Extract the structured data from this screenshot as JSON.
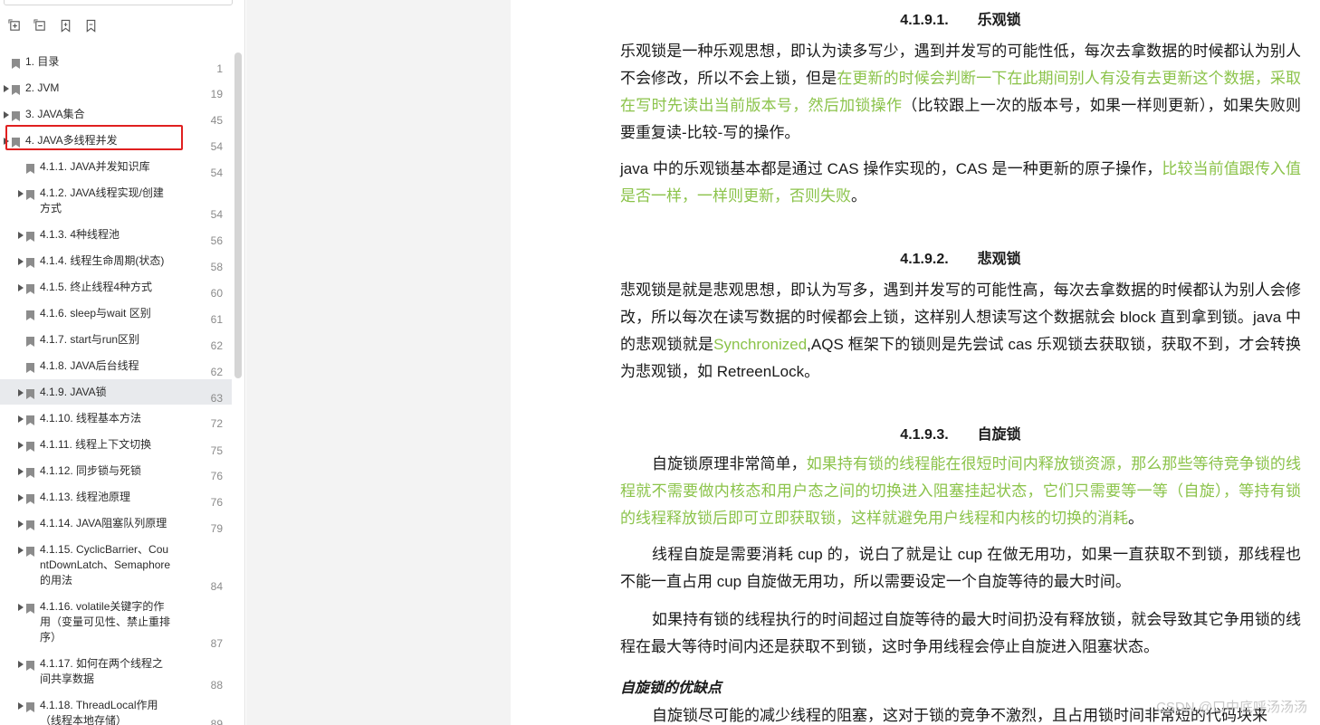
{
  "toolbar": {
    "buttons": [
      {
        "name": "expand-all-icon"
      },
      {
        "name": "collapse-all-icon"
      },
      {
        "name": "add-bookmark-icon"
      },
      {
        "name": "bookmark-icon"
      }
    ]
  },
  "outline": {
    "items": [
      {
        "label": "1. 目录",
        "page": "1",
        "expandable": false,
        "level": 0
      },
      {
        "label": "2. JVM",
        "page": "19",
        "expandable": true,
        "level": 0
      },
      {
        "label": "3. JAVA集合",
        "page": "45",
        "expandable": true,
        "level": 0
      },
      {
        "label": "4. JAVA多线程并发",
        "page": "54",
        "expandable": true,
        "level": 0,
        "highlighted": true
      },
      {
        "label": "4.1.1. JAVA并发知识库",
        "page": "54",
        "expandable": false,
        "level": 1
      },
      {
        "label": "4.1.2. JAVA线程实现/创建方式",
        "page": "54",
        "expandable": true,
        "level": 1
      },
      {
        "label": "4.1.3. 4种线程池",
        "page": "56",
        "expandable": true,
        "level": 1
      },
      {
        "label": "4.1.4. 线程生命周期(状态)",
        "page": "58",
        "expandable": true,
        "level": 1
      },
      {
        "label": "4.1.5. 终止线程4种方式",
        "page": "60",
        "expandable": true,
        "level": 1
      },
      {
        "label": "4.1.6. sleep与wait 区别",
        "page": "61",
        "expandable": false,
        "level": 1
      },
      {
        "label": "4.1.7. start与run区别",
        "page": "62",
        "expandable": false,
        "level": 1
      },
      {
        "label": "4.1.8. JAVA后台线程",
        "page": "62",
        "expandable": false,
        "level": 1
      },
      {
        "label": "4.1.9. JAVA锁",
        "page": "63",
        "expandable": true,
        "level": 1,
        "selected": true
      },
      {
        "label": "4.1.10. 线程基本方法",
        "page": "72",
        "expandable": true,
        "level": 1
      },
      {
        "label": "4.1.11. 线程上下文切换",
        "page": "75",
        "expandable": true,
        "level": 1
      },
      {
        "label": "4.1.12. 同步锁与死锁",
        "page": "76",
        "expandable": true,
        "level": 1
      },
      {
        "label": "4.1.13. 线程池原理",
        "page": "76",
        "expandable": true,
        "level": 1
      },
      {
        "label": "4.1.14. JAVA阻塞队列原理",
        "page": "79",
        "expandable": true,
        "level": 1
      },
      {
        "label": "4.1.15. CyclicBarrier、CountDownLatch、Semaphore的用法",
        "page": "84",
        "expandable": true,
        "level": 1
      },
      {
        "label": "4.1.16. volatile关键字的作用（变量可见性、禁止重排序）",
        "page": "87",
        "expandable": true,
        "level": 1
      },
      {
        "label": "4.1.17. 如何在两个线程之间共享数据",
        "page": "88",
        "expandable": true,
        "level": 1
      },
      {
        "label": "4.1.18. ThreadLocal作用（线程本地存储）",
        "page": "89",
        "expandable": true,
        "level": 1
      }
    ]
  },
  "document": {
    "sections": [
      {
        "num": "4.1.9.1.",
        "title": "乐观锁",
        "paragraphs": [
          {
            "indent": false,
            "segments": [
              {
                "text": "乐观锁是一种乐观思想，即认为读多写少，遇到并发写的可能性低，每次去拿数据的时候都认为别人不会修改，所以不会上锁，但是",
                "green": false
              },
              {
                "text": "在更新的时候会判断一下在此期间别人有没有去更新这个数据，采取在写时先读出当前版本号，然后加锁操作",
                "green": true
              },
              {
                "text": "（比较跟上一次的版本号，如果一样则更新），如果失败则要重复读-比较-写的操作。",
                "green": false
              }
            ]
          },
          {
            "indent": false,
            "segments": [
              {
                "text": "java 中的乐观锁基本都是通过 CAS 操作实现的，CAS 是一种更新的原子操作，",
                "green": false
              },
              {
                "text": "比较当前值跟传入值是否一样，一样则更新，否则失败",
                "green": true
              },
              {
                "text": "。",
                "green": false
              }
            ]
          }
        ]
      },
      {
        "num": "4.1.9.2.",
        "title": "悲观锁",
        "paragraphs": [
          {
            "indent": false,
            "segments": [
              {
                "text": "悲观锁是就是悲观思想，即认为写多，遇到并发写的可能性高，每次去拿数据的时候都认为别人会修改，所以每次在读写数据的时候都会上锁，这样别人想读写这个数据就会 block 直到拿到锁。java 中的悲观锁就是",
                "green": false
              },
              {
                "text": "Synchronized",
                "green": true
              },
              {
                "text": ",AQS 框架下的锁则是先尝试 cas 乐观锁去获取锁，获取不到，才会转换为悲观锁，如 RetreenLock。",
                "green": false
              }
            ]
          }
        ]
      },
      {
        "num": "4.1.9.3.",
        "title": "自旋锁",
        "paragraphs": [
          {
            "indent": true,
            "segments": [
              {
                "text": "自旋锁原理非常简单，",
                "green": false
              },
              {
                "text": "如果持有锁的线程能在很短时间内释放锁资源，那么那些等待竞争锁的线程就不需要做内核态和用户态之间的切换进入阻塞挂起状态，它们只需要等一等（自旋），等持有锁的线程释放锁后即可立即获取锁，这样就避免用户线程和内核的切换的消耗",
                "green": true
              },
              {
                "text": "。",
                "green": false
              }
            ]
          },
          {
            "indent": true,
            "segments": [
              {
                "text": "线程自旋是需要消耗 cup 的，说白了就是让 cup 在做无用功，如果一直获取不到锁，那线程也不能一直占用 cup 自旋做无用功，所以需要设定一个自旋等待的最大时间。",
                "green": false
              }
            ]
          },
          {
            "indent": true,
            "segments": [
              {
                "text": "如果持有锁的线程执行的时间超过自旋等待的最大时间扔没有释放锁，就会导致其它争用锁的线程在最大等待时间内还是获取不到锁，这时争用线程会停止自旋进入阻塞状态。",
                "green": false
              }
            ]
          }
        ]
      }
    ],
    "subheading": "自旋锁的优缺点",
    "last_paragraph": "自旋锁尽可能的减少线程的阻塞，这对于锁的竞争不激烈，且占用锁时间非常短的代码块来",
    "watermark": "CSDN @口中底呼汤汤汤"
  },
  "colors": {
    "green_text": "#8bc34a",
    "highlight_box": "#e02020",
    "selected_row": "#e8eaed"
  }
}
